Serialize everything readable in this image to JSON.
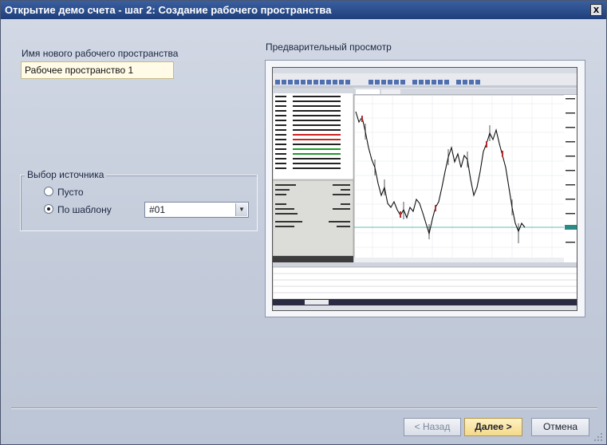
{
  "window": {
    "title": "Открытие демо счета - шаг 2: Создание рабочего пространства",
    "close_glyph": "x"
  },
  "workspace": {
    "label": "Имя нового рабочего пространства",
    "value": "Рабочее пространство 1"
  },
  "source": {
    "legend": "Выбор источника",
    "options": [
      {
        "label": "Пусто",
        "checked": false
      },
      {
        "label": "По шаблону",
        "checked": true
      }
    ],
    "template_selected": "#01"
  },
  "preview": {
    "label": "Предварительный просмотр"
  },
  "buttons": {
    "back": "< Назад",
    "next": "Далее >",
    "cancel": "Отмена"
  }
}
